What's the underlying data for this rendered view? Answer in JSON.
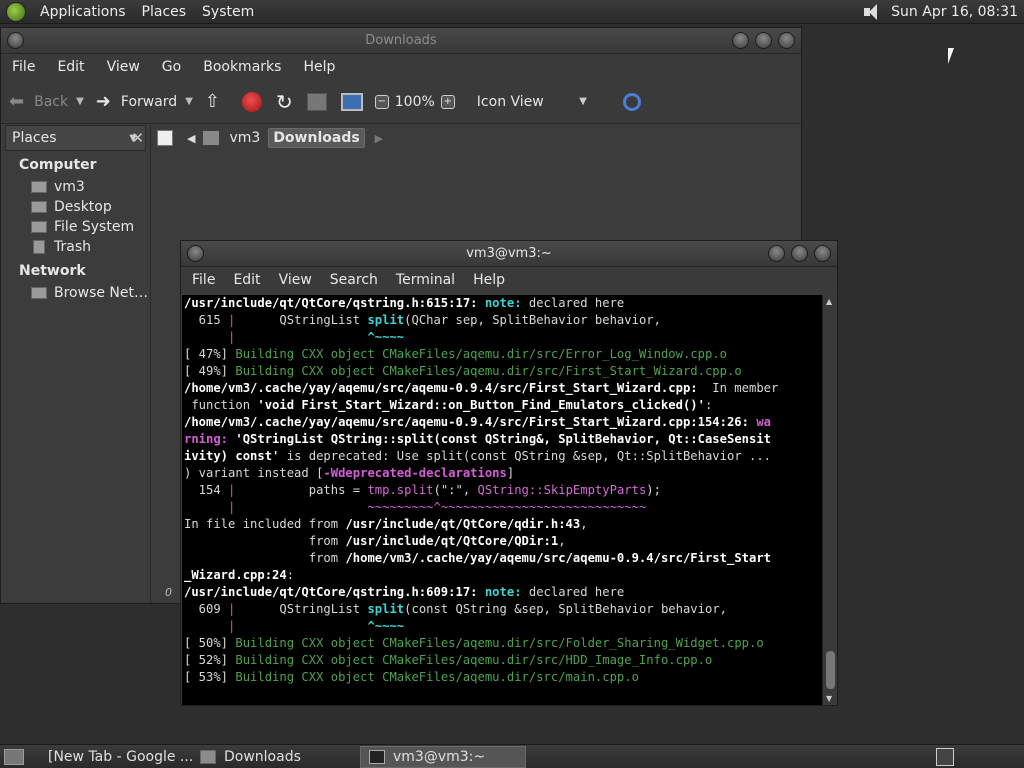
{
  "top_panel": {
    "menus": [
      "Applications",
      "Places",
      "System"
    ],
    "clock": "Sun Apr 16, 08:31"
  },
  "file_manager": {
    "title": "Downloads",
    "menu": [
      "File",
      "Edit",
      "View",
      "Go",
      "Bookmarks",
      "Help"
    ],
    "toolbar": {
      "back": "Back",
      "forward": "Forward",
      "zoom": "100%",
      "view_mode": "Icon View"
    },
    "sidebar": {
      "header": "Places",
      "sections": [
        {
          "title": "Computer",
          "items": [
            "vm3",
            "Desktop",
            "File System",
            "Trash"
          ]
        },
        {
          "title": "Network",
          "items": [
            "Browse Net…"
          ]
        }
      ]
    },
    "path": [
      "vm3",
      "Downloads"
    ],
    "status": "0"
  },
  "terminal": {
    "title": "vm3@vm3:~",
    "menu": [
      "File",
      "Edit",
      "View",
      "Search",
      "Terminal",
      "Help"
    ]
  },
  "taskbar": {
    "tasks": [
      "[New Tab - Google ...",
      "Downloads",
      "vm3@vm3:~"
    ]
  }
}
